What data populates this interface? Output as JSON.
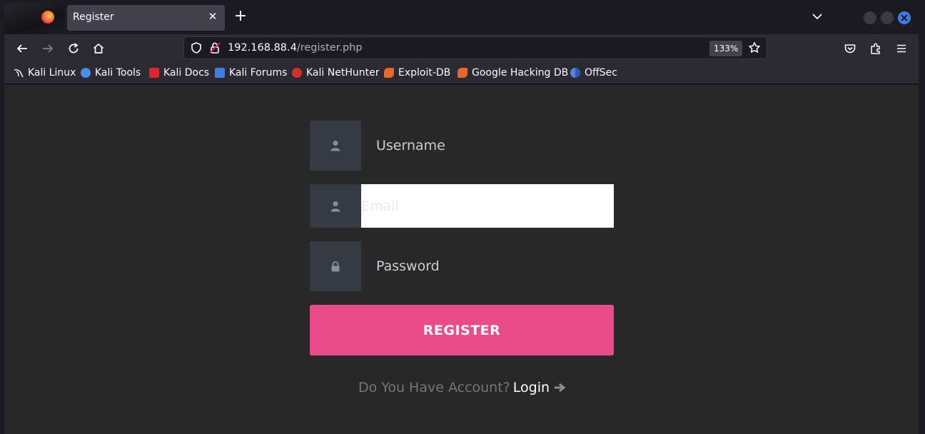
{
  "browser": {
    "tab": {
      "title": "Register"
    },
    "url": {
      "host": "192.168.88.4",
      "path": "/register.php"
    },
    "zoom": "133%",
    "bookmarks": [
      {
        "label": "Kali Linux",
        "icon": "kali-dragon-icon",
        "color": "#1c1b22"
      },
      {
        "label": "Kali Tools",
        "icon": "kali-tools-icon",
        "color": "#4a8fe7"
      },
      {
        "label": "Kali Docs",
        "icon": "kali-docs-icon",
        "color": "#e0262b"
      },
      {
        "label": "Kali Forums",
        "icon": "kali-forums-icon",
        "color": "#3f7fe0"
      },
      {
        "label": "Kali NetHunter",
        "icon": "kali-nethunter-icon",
        "color": "#d32f2f"
      },
      {
        "label": "Exploit-DB",
        "icon": "exploit-db-icon",
        "color": "#e8682b"
      },
      {
        "label": "Google Hacking DB",
        "icon": "ghdb-icon",
        "color": "#e8682b"
      },
      {
        "label": "OffSec",
        "icon": "offsec-icon",
        "color": "#4f86d9"
      }
    ]
  },
  "form": {
    "username_placeholder": "Username",
    "email_placeholder": "Email",
    "password_placeholder": "Password",
    "register_label": "REGISTER",
    "login_question": "Do You Have Account?",
    "login_link": "Login"
  },
  "colors": {
    "accent": "#e94c89",
    "page_bg": "#282828",
    "icon_box": "#353a43"
  }
}
